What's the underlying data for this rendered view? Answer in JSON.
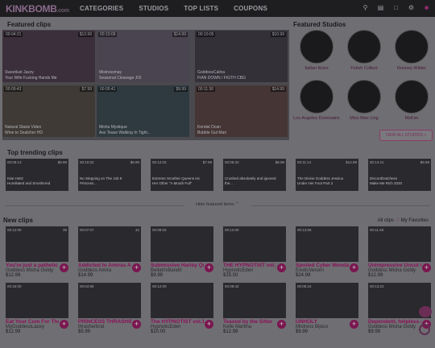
{
  "header": {
    "logo": "KINKBOMB",
    "logo_suffix": ".com",
    "nav": [
      "CATEGORIES",
      "STUDIOS",
      "TOP LISTS",
      "COUPONS"
    ]
  },
  "featured": {
    "title": "Featured clips",
    "clips": [
      {
        "tl": "00:04:21",
        "tr": "$13.99",
        "cap1": "Sweetlust Jazzy",
        "cap2": "Your Wife Fucking Hands Me"
      },
      {
        "tl": "00:10:09",
        "tr": "$14.99",
        "cap1": "Mistressmay",
        "cap2": "Seasonal Cleavage JOI"
      },
      {
        "tl": "00:10:05",
        "tr": "$10.99",
        "cap1": "GoddessCalina",
        "cap2": "FIAN DOWN / FIGTH CBG"
      },
      {
        "tl": "00:09:43",
        "tr": "$7.99",
        "cap1": "Natural Stasis Video",
        "cap2": "Wine to Snatcher HD"
      },
      {
        "tl": "00:05:41",
        "tr": "$9.99",
        "cap1": "Misha Mystique",
        "cap2": "Ass Tease Walking In Tight..."
      },
      {
        "tl": "00:11:36",
        "tr": "$14.99",
        "cap1": "Kendal Ocan",
        "cap2": "Bubble Gut Mari"
      }
    ]
  },
  "studios": {
    "title": "Featured Studios",
    "items": [
      "Italian Kicks",
      "Fetish Collect",
      "Rooney Wilder",
      "Los Angeles Dominatrix",
      "Miss Mae Ling",
      "MzKim"
    ],
    "view_all": "VIEW ALL STUDIOS »"
  },
  "trending": {
    "title": "Top trending clips",
    "clips": [
      {
        "tl": "00:08:13",
        "tr": "$9.99",
        "cap": "Kiwi Hottz\nHumiliated and Smothered"
      },
      {
        "tl": "00:10:02",
        "tr": "$9.99",
        "cap": "No Stepping on The Job 9\nPrincess..."
      },
      {
        "tl": "00:12:03",
        "tr": "$7.99",
        "cap": "Extreme Smother Queens Inc\nHer Other \"A Mouth Full\""
      },
      {
        "tl": "00:08:20",
        "tr": "$9.99",
        "cap": "Crushed absolutely and ignored\nthe..."
      },
      {
        "tl": "00:11:14",
        "tr": "$14.99",
        "cap": "The Divine Goddess Jessica\nUnder Her Foot Part 2"
      },
      {
        "tl": "00:14:21",
        "tr": "$9.99",
        "cap": "DiscordDutchess\nMake Me Rich 2020"
      }
    ]
  },
  "hide_text": "Hide featured items",
  "new": {
    "title": "New clips",
    "links": {
      "all": "All clips",
      "fav": "My Favorites"
    },
    "clips": [
      {
        "tl": "00:12:00",
        "tr": "39",
        "title": "You're just a pathetic l",
        "author": "Goddess Misha Goldy",
        "price": "$12.99"
      },
      {
        "tl": "00:07:07",
        "tr": "42",
        "title": "Addicted to Amiras Ass",
        "author": "Goddess Amira",
        "price": "$14.99"
      },
      {
        "tl": "00:08:03",
        "tr": "",
        "title": "Submissive Harley Quinn",
        "author": "BellatrixBandit",
        "price": "$9.99"
      },
      {
        "tl": "00:12:00",
        "tr": "",
        "title": "THE HYPNOTIST vol.1 Ex",
        "author": "HypnoticEden",
        "price": "$15.00"
      },
      {
        "tl": "00:13:06",
        "tr": "",
        "title": "Spoiled Cyber Monday",
        "author": "ExoticVenom",
        "price": "$24.99"
      },
      {
        "tl": "00:11:48",
        "tr": "",
        "title": "Unimpressive Uncut Cock",
        "author": "Goddess Misha Goldy",
        "price": "$12.99"
      },
      {
        "tl": "00:15:00",
        "tr": "",
        "title": "Eat Your Cum For The Er",
        "author": "MyGoddessLacey",
        "price": "$12.99"
      },
      {
        "tl": "00:04:55",
        "tr": "",
        "title": "PRINCESS THRASHIE EN",
        "author": "thrasherbrat",
        "price": "$5.99"
      },
      {
        "tl": "00:12:00",
        "tr": "",
        "title": "The HYPNOTIST vol.1 Ex",
        "author": "HypnoticEden",
        "price": "$10.00"
      },
      {
        "tl": "00:08:42",
        "tr": "",
        "title": "Teased by the Sitter",
        "author": "Kelle Martina",
        "price": "$12.99"
      },
      {
        "tl": "00:05:24",
        "tr": "",
        "title": "UNHOLY",
        "author": "Mistress Bijoux",
        "price": "$9.99"
      },
      {
        "tl": "00:13:22",
        "tr": "",
        "title": "Dependent, helpless and",
        "author": "Goddess Misha Goldy",
        "price": "$9.99"
      }
    ]
  }
}
